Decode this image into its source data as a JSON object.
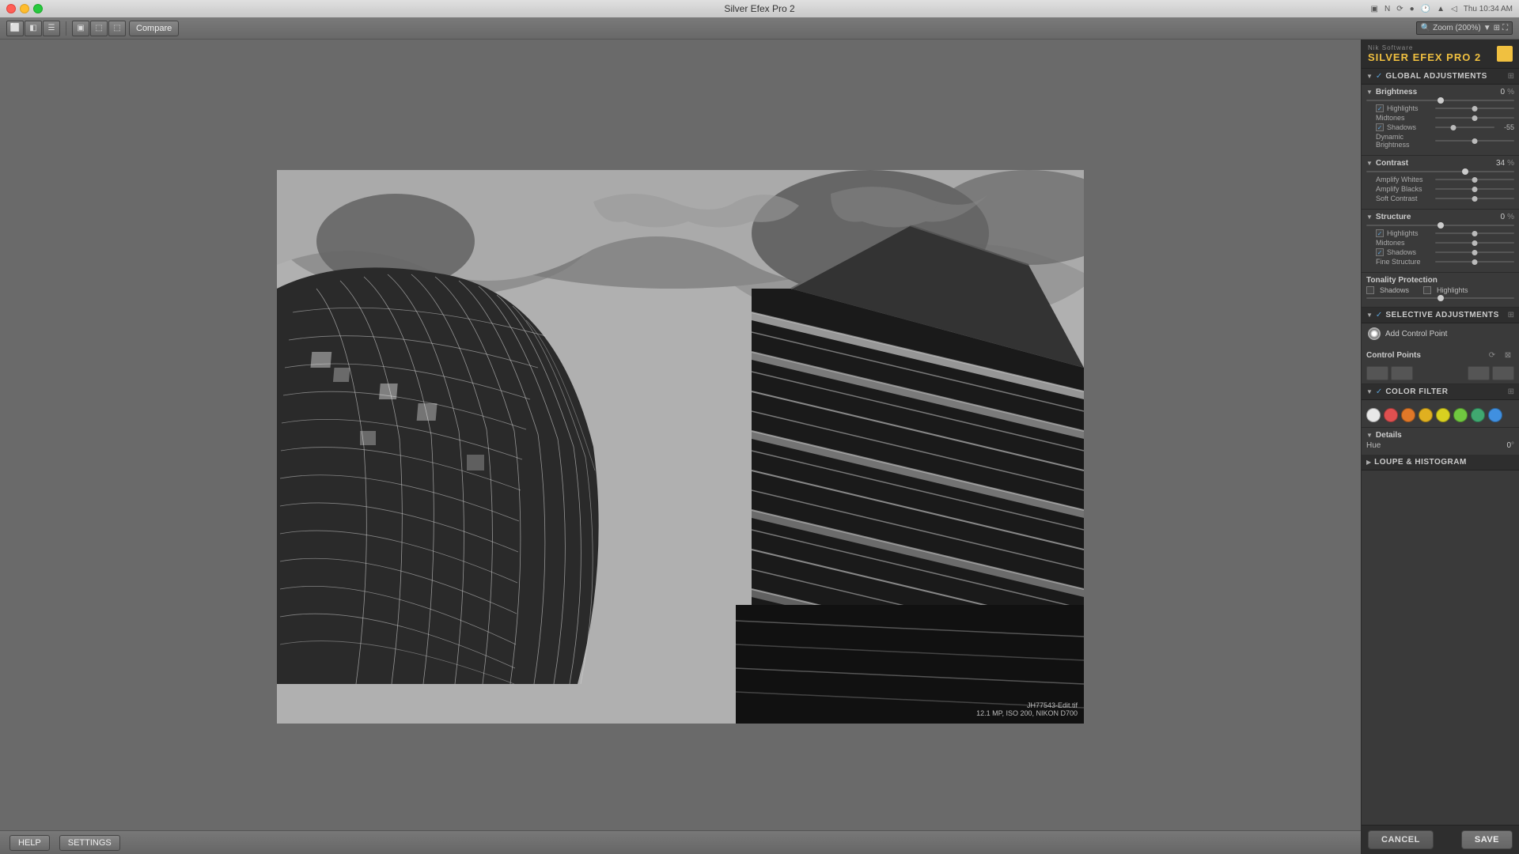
{
  "window": {
    "title": "Silver Efex Pro 2",
    "datetime": "Thu 10:34 AM"
  },
  "titlebar": {
    "title": "Silver Efex Pro 2"
  },
  "toolbar": {
    "compare_label": "Compare",
    "zoom_label": "Zoom (200%)",
    "zoom_value": "Zoom (200%)"
  },
  "brand": {
    "nik": "Nik Software",
    "name": "SILVER EFEX PRO",
    "version": "2"
  },
  "sections": {
    "global_adjustments": "GLOBAL ADJUSTMENTS",
    "selective_adjustments": "SELECTIVE ADJUSTMENTS",
    "control_points": "Control Points",
    "color_filter": "COLOR FILTER",
    "details": "Details",
    "loupe_histogram": "LOUPE & HISTOGRAM"
  },
  "brightness": {
    "label": "Brightness",
    "value": "0",
    "unit": "%",
    "highlights_label": "Highlights",
    "midtones_label": "Midtones",
    "shadows_label": "Shadows",
    "shadows_value": "-55",
    "dynamic_brightness_label": "Dynamic Brightness"
  },
  "contrast": {
    "label": "Contrast",
    "value": "34",
    "unit": "%",
    "amplify_whites_label": "Amplify Whites",
    "amplify_blacks_label": "Amplify Blacks",
    "soft_contrast_label": "Soft Contrast"
  },
  "structure": {
    "label": "Structure",
    "value": "0",
    "unit": "%",
    "highlights_label": "Highlights",
    "midtones_label": "Midtones",
    "shadows_label": "Shadows",
    "fine_structure_label": "Fine Structure"
  },
  "tonality": {
    "label": "Tonality Protection",
    "shadows_label": "Shadows",
    "highlights_label": "Highlights"
  },
  "selective": {
    "add_control_point": "Add Control Point"
  },
  "color_filter": {
    "label": "COLOR FILTER",
    "colors": [
      "#e8e8e8",
      "#e05050",
      "#e07828",
      "#e0b020",
      "#d8d020",
      "#70c840",
      "#40a870",
      "#4090e0"
    ]
  },
  "details": {
    "label": "Details",
    "hue_label": "Hue",
    "hue_value": "0",
    "hue_unit": "°"
  },
  "footer": {
    "cancel_label": "CANCEL",
    "save_label": "SAVE"
  },
  "photo": {
    "caption_line1": "JH77543-Edit.tif",
    "caption_line2": "12.1 MP, ISO 200, NIKON D700"
  },
  "bottom": {
    "help_label": "HELP",
    "settings_label": "SETTINGS"
  }
}
